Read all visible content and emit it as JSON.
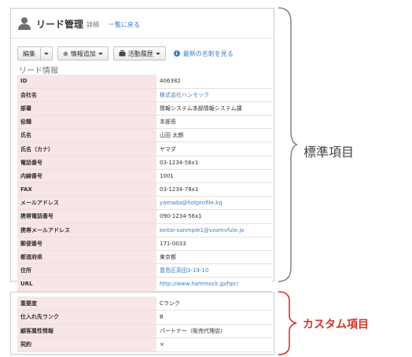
{
  "header": {
    "title": "リード管理",
    "subtitle": "詳細",
    "back_link": "一覧に戻る"
  },
  "toolbar": {
    "edit_label": "編集",
    "add_info_label": "情報追加",
    "activity_label": "活動履歴",
    "latest_card_link": "最新の名刺を見る"
  },
  "section_title": "リード情報",
  "standard_fields": [
    {
      "label": "ID",
      "value": "406382"
    },
    {
      "label": "会社名",
      "value": "株式会社ハンモック"
    },
    {
      "label": "部署",
      "value": "情報システム本部情報システム課"
    },
    {
      "label": "役職",
      "value": "本部長"
    },
    {
      "label": "氏名",
      "value": "山田 太朗"
    },
    {
      "label": "氏名（カナ）",
      "value": "ヤマダ"
    },
    {
      "label": "電話番号",
      "value": "03-1234-56x1"
    },
    {
      "label": "内線番号",
      "value": "1001"
    },
    {
      "label": "FAX",
      "value": "03-1234-78x1"
    },
    {
      "label": "メールアドレス",
      "value": "yamada@hotprofile.kq"
    },
    {
      "label": "携帯電話番号",
      "value": "090-1234-56x1"
    },
    {
      "label": "携帯メールアドレス",
      "value": "keitai-sanmple1@vzomvfule.jx"
    },
    {
      "label": "郵便番号",
      "value": "171-0033"
    },
    {
      "label": "都道府県",
      "value": "東京都"
    },
    {
      "label": "住所",
      "value": "豊島区高田3-19-10"
    },
    {
      "label": "URL",
      "value": "http://www.hammock.jp/hpr/"
    }
  ],
  "custom_fields": [
    {
      "label": "重要度",
      "value": "Cランク"
    },
    {
      "label": "仕入れ先ランク",
      "value": "B"
    },
    {
      "label": "顧客属性情報",
      "value": "パートナー（販売代理店）"
    },
    {
      "label": "契約",
      "value": "×"
    }
  ],
  "annotations": {
    "standard": "標準項目",
    "custom": "カスタム項目"
  },
  "colors": {
    "label_bg": "#f8e5e5",
    "link": "#3a7dc9",
    "custom_annotation": "#d9312b",
    "brace_standard": "#888888"
  },
  "icons": {
    "header": "person-icon",
    "add_info": "plus-circle-icon",
    "activity": "briefcase-icon",
    "info": "info-icon"
  }
}
